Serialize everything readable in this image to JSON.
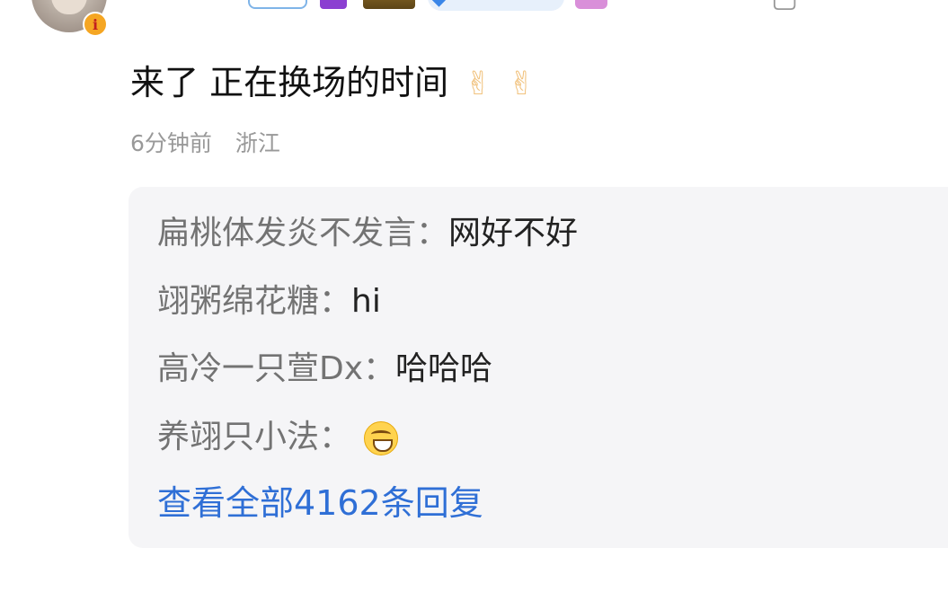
{
  "comment": {
    "text": "来了 正在换场的时间",
    "emojis": [
      "✌",
      "✌"
    ],
    "time": "6分钟前",
    "location": "浙江"
  },
  "replies": [
    {
      "name": "扁桃体发炎不发言：",
      "text": "网好不好"
    },
    {
      "name": "翊粥绵花糖：",
      "text": "hi"
    },
    {
      "name": "高冷一只萱Dx：",
      "text": "哈哈哈"
    },
    {
      "name": "养翊只小法：",
      "emoji": "grinning-face-emoji"
    }
  ],
  "view_all_label": "查看全部4162条回复",
  "colors": {
    "link": "#2f6fd6",
    "username": "#e8533d",
    "muted": "#999999",
    "panel_bg": "#f5f5f7"
  }
}
